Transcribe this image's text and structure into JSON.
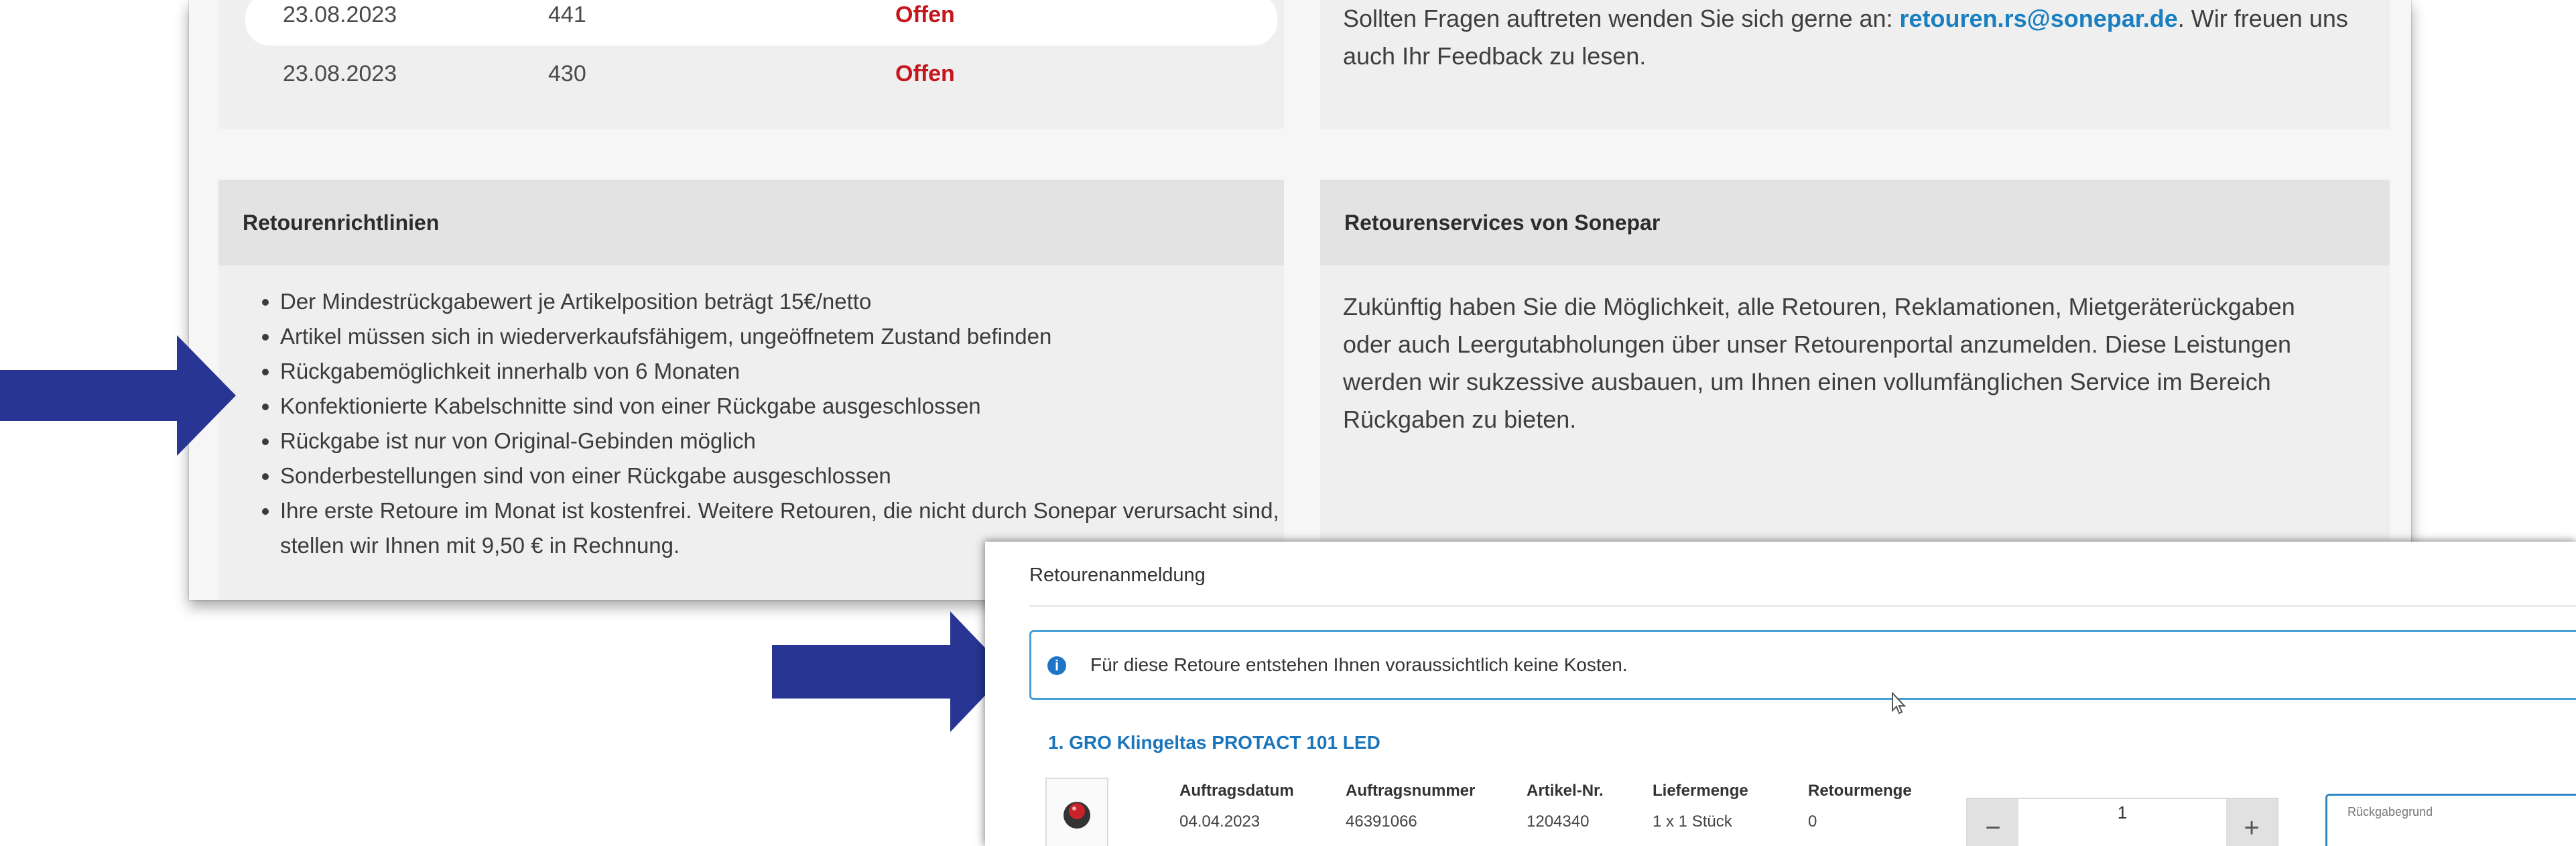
{
  "orders_table": {
    "rows": [
      {
        "date": "23.08.2023",
        "number": "441",
        "status": "Offen"
      },
      {
        "date": "23.08.2023",
        "number": "430",
        "status": "Offen"
      }
    ]
  },
  "contact": {
    "text_before": "Sollten Fragen auftreten wenden Sie sich gerne an: ",
    "email": "retouren.rs@sonepar.de",
    "text_after": ". Wir freuen uns auch Ihr Feedback zu lesen."
  },
  "policies": {
    "title": "Retourenrichtlinien",
    "items": [
      "Der Mindestrückgabewert je Artikelposition beträgt 15€/netto",
      "Artikel müssen sich in wiederverkaufsfähigem, ungeöffnetem Zustand befinden",
      "Rückgabemöglichkeit innerhalb von 6 Monaten",
      "Konfektionierte Kabelschnitte sind von einer Rückgabe ausgeschlossen",
      "Rückgabe ist nur von Original-Gebinden möglich",
      "Sonderbestellungen sind von einer Rückgabe ausgeschlossen",
      "Ihre erste Retoure im Monat ist kostenfrei. Weitere Retouren, die nicht durch Sonepar verursacht sind, stellen wir Ihnen mit 9,50 € in Rechnung."
    ]
  },
  "services": {
    "title": "Retourenservices von Sonepar",
    "text": "Zukünftig haben Sie die Möglichkeit, alle Retouren, Reklamationen, Mietgeräterückgaben oder auch Leergutabholungen über unser Retourenportal anzumelden. Diese Leistungen werden wir sukzessive ausbauen, um Ihnen einen vollumfänglichen Service im Bereich Rückgaben zu bieten."
  },
  "registration": {
    "title": "Retourenanmeldung",
    "info_icon": "info-icon",
    "info_text": "Für diese Retoure entstehen Ihnen voraussichtlich keine Kosten.",
    "product_title": "1. GRO Klingeltas PROTACT 101 LED",
    "headers": {
      "order_date": "Auftragsdatum",
      "order_number": "Auftragsnummer",
      "article_no": "Artikel-Nr.",
      "delivered": "Liefermenge",
      "returned": "Retourmenge"
    },
    "values": {
      "order_date": "04.04.2023",
      "order_number": "46391066",
      "article_no": "1204340",
      "delivered": "1 x 1 Stück",
      "returned": "0"
    },
    "quantity": {
      "minus": "−",
      "value": "1",
      "plus": "+"
    },
    "reason_label": "Rückgabegrund"
  },
  "colors": {
    "arrow": "#283593",
    "status_open": "#c4161c",
    "link": "#1a7fc1",
    "accent": "#2f86c5"
  }
}
